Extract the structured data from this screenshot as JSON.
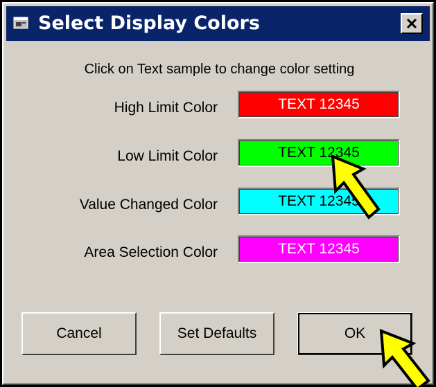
{
  "window": {
    "title": "Select Display Colors",
    "close_label": "×"
  },
  "instruction": "Click on Text sample to change color setting",
  "color_rows": [
    {
      "label": "High Limit Color",
      "sample_text": "TEXT 12345",
      "bg": "#ff0000",
      "fg": "#ffffff"
    },
    {
      "label": "Low Limit Color",
      "sample_text": "TEXT 12345",
      "bg": "#00ff00",
      "fg": "#000000"
    },
    {
      "label": "Value Changed Color",
      "sample_text": "TEXT 12345",
      "bg": "#00ffff",
      "fg": "#000000"
    },
    {
      "label": "Area Selection Color",
      "sample_text": "TEXT 12345",
      "bg": "#ff00ff",
      "fg": "#ffffff"
    }
  ],
  "buttons": {
    "cancel": "Cancel",
    "set_defaults": "Set Defaults",
    "ok": "OK"
  },
  "colors": {
    "title_bar": "#0a246a",
    "dialog_face": "#d4d0c8",
    "annotation_arrow": "#ffff00"
  },
  "annotations": [
    "yellow-arrow-pointing-at-low-limit-sample",
    "yellow-arrow-pointing-at-ok-button"
  ]
}
